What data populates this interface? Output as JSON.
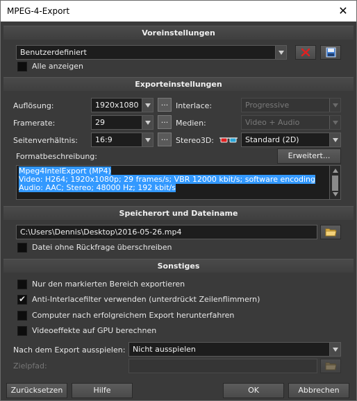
{
  "window": {
    "title": "MPEG-4-Export",
    "close_glyph": "✕"
  },
  "presets": {
    "header": "Voreinstellungen",
    "selected": "Benutzerdefiniert",
    "show_all_label": "Alle anzeigen",
    "show_all_checked": false,
    "delete_icon": "red-x-delete-icon",
    "save_icon": "floppy-disk-save-icon"
  },
  "export_settings": {
    "header": "Exporteinstellungen",
    "resolution_label": "Auflösung:",
    "resolution_value": "1920x1080",
    "framerate_label": "Framerate:",
    "framerate_value": "29",
    "aspect_label": "Seitenverhältnis:",
    "aspect_value": "16:9",
    "dots_label": "...",
    "interlace_label": "Interlace:",
    "interlace_value": "Progressive",
    "media_label": "Medien:",
    "media_value": "Video + Audio",
    "stereo_label": "Stereo3D:",
    "stereo_value": "Standard (2D)",
    "format_desc_label": "Formatbeschreibung:",
    "advanced_button": "Erweitert...",
    "description_lines": [
      "Mpeg4IntelExport (MP4)",
      "Video: H264; 1920x1080p; 29 frames/s; VBR 12000 kbit/s; software encoding",
      "Audio: AAC; Stereo; 48000 Hz; 192 kbit/s"
    ]
  },
  "location": {
    "header": "Speicherort und Dateiname",
    "path": "C:\\Users\\Dennis\\Desktop\\2016-05-26.mp4",
    "overwrite_label": "Datei ohne Rückfrage überschreiben",
    "overwrite_checked": false
  },
  "misc": {
    "header": "Sonstiges",
    "options": [
      {
        "label": "Nur den markierten Bereich exportieren",
        "checked": false
      },
      {
        "label": "Anti-Interlacefilter verwenden (unterdrückt Zeilenflimmern)",
        "checked": true
      },
      {
        "label": "Computer nach erfolgreichem Export herunterfahren",
        "checked": false
      },
      {
        "label": "Videoeffekte auf GPU berechnen",
        "checked": false
      }
    ],
    "after_export_label": "Nach dem Export ausspielen:",
    "after_export_value": "Nicht ausspielen",
    "target_path_label": "Zielpfad:",
    "target_path_value": ""
  },
  "footer": {
    "reset": "Zurücksetzen",
    "help": "Hilfe",
    "ok": "OK",
    "cancel": "Abbrechen"
  },
  "colors": {
    "selection": "#3399ff",
    "delete_red": "#e02020",
    "folder_yellow": "#e8b84a"
  }
}
